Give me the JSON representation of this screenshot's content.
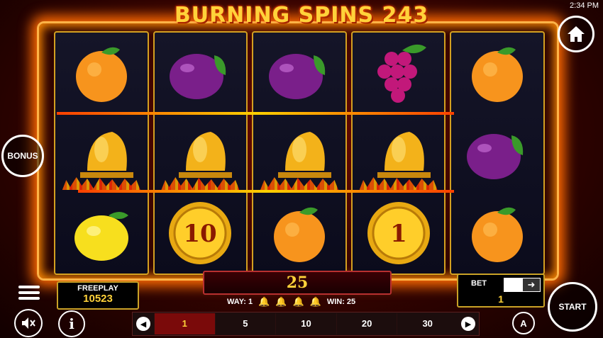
{
  "title": "BURNING SPINS 243",
  "clock": "2:34 PM",
  "reels": [
    [
      "orange",
      "bell",
      "lemon"
    ],
    [
      "plum",
      "bell",
      "coin"
    ],
    [
      "plum",
      "bell",
      "orange"
    ],
    [
      "grapes",
      "bell",
      "coin"
    ],
    [
      "orange",
      "plum",
      "orange"
    ]
  ],
  "coins": {
    "r2": "10",
    "r4": "1"
  },
  "buttons": {
    "bonus": "BONUS",
    "start": "START",
    "info": "i",
    "auto": "A"
  },
  "freeplay": {
    "label": "FREEPLAY",
    "value": "10523"
  },
  "win_amount": "25",
  "way": {
    "way_text": "WAY: 1",
    "win_text": "WIN: 25"
  },
  "bet": {
    "label": "BET",
    "value": "1"
  },
  "bet_options": [
    "1",
    "5",
    "10",
    "20",
    "30"
  ],
  "selected_bet": "1",
  "colors": {
    "accent": "#ffd23a",
    "frame": "#ff6a00",
    "selected": "#7a0a0a"
  }
}
